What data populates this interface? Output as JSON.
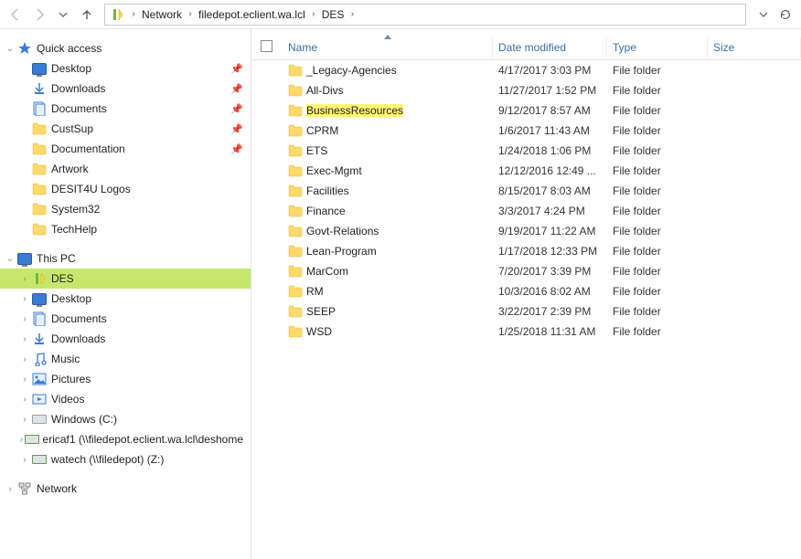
{
  "toolbar": {
    "back_tip": "Back",
    "fwd_tip": "Forward",
    "history_tip": "History",
    "up_tip": "Up",
    "refresh_tip": "Refresh"
  },
  "breadcrumb": [
    "Network",
    "filedepot.eclient.wa.lcl",
    "DES"
  ],
  "columns": {
    "name": "Name",
    "date": "Date modified",
    "type": "Type",
    "size": "Size"
  },
  "typestr": "File folder",
  "files": [
    {
      "name": "_Legacy-Agencies",
      "date": "4/17/2017 3:03 PM"
    },
    {
      "name": "All-Divs",
      "date": "11/27/2017 1:52 PM"
    },
    {
      "name": "BusinessResources",
      "date": "9/12/2017 8:57 AM",
      "highlight": true
    },
    {
      "name": "CPRM",
      "date": "1/6/2017 11:43 AM"
    },
    {
      "name": "ETS",
      "date": "1/24/2018 1:06 PM"
    },
    {
      "name": "Exec-Mgmt",
      "date": "12/12/2016 12:49 ..."
    },
    {
      "name": "Facilities",
      "date": "8/15/2017 8:03 AM"
    },
    {
      "name": "Finance",
      "date": "3/3/2017 4:24 PM"
    },
    {
      "name": "Govt-Relations",
      "date": "9/19/2017 11:22 AM"
    },
    {
      "name": "Lean-Program",
      "date": "1/17/2018 12:33 PM"
    },
    {
      "name": "MarCom",
      "date": "7/20/2017 3:39 PM"
    },
    {
      "name": "RM",
      "date": "10/3/2016 8:02 AM"
    },
    {
      "name": "SEEP",
      "date": "3/22/2017 2:39 PM"
    },
    {
      "name": "WSD",
      "date": "1/25/2018 11:31 AM"
    }
  ],
  "tree": {
    "quick_access": "Quick access",
    "qa_items": [
      {
        "label": "Desktop",
        "icon": "monitor",
        "pinned": true
      },
      {
        "label": "Downloads",
        "icon": "down",
        "pinned": true
      },
      {
        "label": "Documents",
        "icon": "doc",
        "pinned": true
      },
      {
        "label": "CustSup",
        "icon": "folder",
        "pinned": true
      },
      {
        "label": "Documentation",
        "icon": "folder",
        "pinned": true
      },
      {
        "label": "Artwork",
        "icon": "folder",
        "pinned": false
      },
      {
        "label": "DESIT4U Logos",
        "icon": "folder",
        "pinned": false
      },
      {
        "label": "System32",
        "icon": "folder",
        "pinned": false
      },
      {
        "label": "TechHelp",
        "icon": "folder",
        "pinned": false
      }
    ],
    "this_pc": "This PC",
    "pc_items": [
      {
        "label": "DES",
        "icon": "netloc",
        "selected": true,
        "expand": true
      },
      {
        "label": "Desktop",
        "icon": "monitor"
      },
      {
        "label": "Documents",
        "icon": "doc"
      },
      {
        "label": "Downloads",
        "icon": "down"
      },
      {
        "label": "Music",
        "icon": "music"
      },
      {
        "label": "Pictures",
        "icon": "pic"
      },
      {
        "label": "Videos",
        "icon": "vid"
      },
      {
        "label": "Windows (C:)",
        "icon": "drive"
      },
      {
        "label": "ericaf1 (\\\\filedepot.eclient.wa.lcl\\deshome",
        "icon": "netdrive"
      },
      {
        "label": "watech (\\\\filedepot) (Z:)",
        "icon": "netdrive"
      }
    ],
    "network": "Network"
  }
}
